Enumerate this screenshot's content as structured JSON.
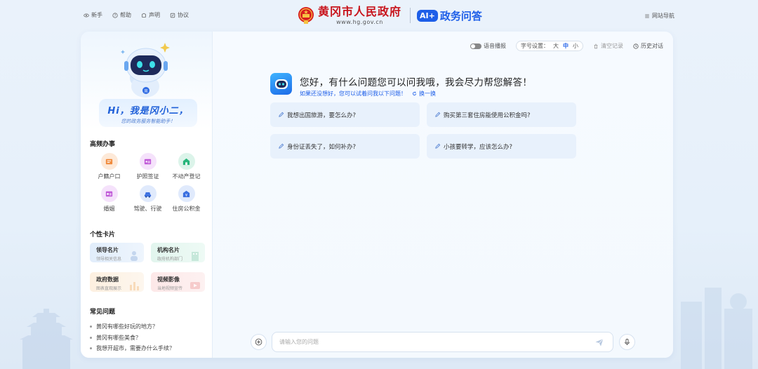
{
  "header": {
    "links": [
      {
        "label": "新手",
        "icon": "eye-icon"
      },
      {
        "label": "帮助",
        "icon": "help-icon"
      },
      {
        "label": "声明",
        "icon": "statement-icon"
      },
      {
        "label": "协议",
        "icon": "agreement-icon"
      }
    ],
    "gov_title": "黄冈市人民政府",
    "gov_url": "www.hg.gov.cn",
    "ai_badge": "AI+",
    "ai_title": "政务问答",
    "site_nav": "网站导航"
  },
  "sidebar": {
    "greeting": "Hi，我是冈小二，",
    "greeting_sub": "您的政务服务智能助手！",
    "services_title": "高频办事",
    "services": [
      {
        "label": "户籍户口",
        "icon": "household-register-icon",
        "color": "#f08a3c"
      },
      {
        "label": "护照签证",
        "icon": "passport-icon",
        "color": "#c05ad8"
      },
      {
        "label": "不动产登记",
        "icon": "property-icon",
        "color": "#26b57a"
      },
      {
        "label": "婚姻",
        "icon": "marriage-icon",
        "color": "#c05ad8"
      },
      {
        "label": "驾驶、行驶",
        "icon": "car-icon",
        "color": "#3a6fe0"
      },
      {
        "label": "住房公积金",
        "icon": "housing-fund-icon",
        "color": "#3a6fe0"
      }
    ],
    "cards_title": "个性卡片",
    "cards": [
      {
        "title": "领导名片",
        "sub": "领导相关信息"
      },
      {
        "title": "机构名片",
        "sub": "政府机构部门"
      },
      {
        "title": "政府数据",
        "sub": "图表直观展示"
      },
      {
        "title": "视频影像",
        "sub": "当地视频宣传"
      }
    ],
    "faq_title": "常见问题",
    "faq": [
      "黄冈有哪些好玩的地方？",
      "黄冈有哪些美食？",
      "我想开超市，需要办什么手续？"
    ]
  },
  "toolbar": {
    "voice": "语音播报",
    "font_label": "字号设置：",
    "font_options": [
      "大",
      "中",
      "小"
    ],
    "font_selected": "中",
    "clear": "清空记录",
    "history": "历史对话"
  },
  "chat": {
    "welcome": "您好，有什么问题您可以问我哦，我会尽力帮您解答！",
    "hint": "如果还没想好，您可以试着问我以下问题！",
    "refresh": "换一换",
    "questions": [
      "我想出国旅游，要怎么办?",
      "购买第三套住房能使用公积金吗?",
      "身份证丢失了，如何补办?",
      "小孩要转学，应该怎么办?"
    ],
    "input_placeholder": "请输入您的问题"
  }
}
